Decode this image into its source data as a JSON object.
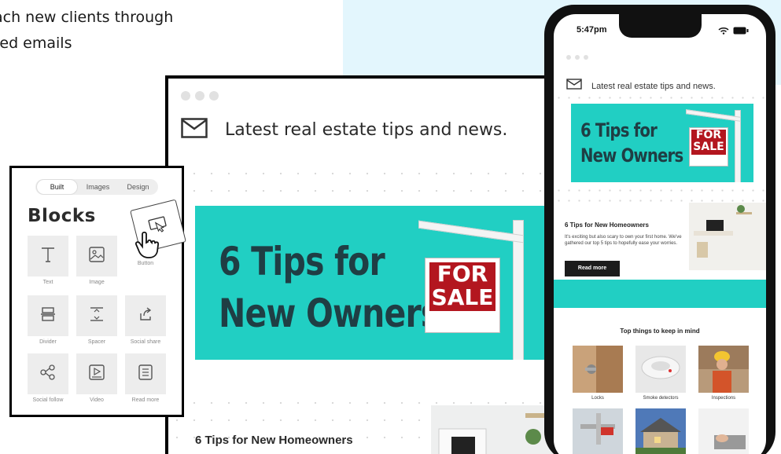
{
  "hero": {
    "line1": "ach new clients through",
    "line2": "red emails"
  },
  "desktop": {
    "mail_title": "Latest real estate tips and news.",
    "banner_line1": "6 Tips for",
    "banner_line2": "New Owners",
    "sign_top": "FOR",
    "sign_bottom": "SALE",
    "article_title": "6  Tips for New Homeowners"
  },
  "builder": {
    "tabs": [
      "Built",
      "Images",
      "Design"
    ],
    "title": "Blocks",
    "blocks": [
      {
        "label": "Text",
        "icon": "text-icon"
      },
      {
        "label": "Image",
        "icon": "image-icon"
      },
      {
        "label": "Button",
        "icon": "cursor-icon"
      },
      {
        "label": "Divider",
        "icon": "divider-icon"
      },
      {
        "label": "Spacer",
        "icon": "spacer-icon"
      },
      {
        "label": "Social share",
        "icon": "share-icon"
      },
      {
        "label": "Social follow",
        "icon": "social-follow-icon"
      },
      {
        "label": "Video",
        "icon": "video-icon"
      },
      {
        "label": "Read more",
        "icon": "read-more-icon"
      }
    ]
  },
  "phone": {
    "time": "5:47pm",
    "mail_title": "Latest real estate tips and news.",
    "banner_line1": "6 Tips for",
    "banner_line2": "New Owners",
    "sign_top": "FOR",
    "sign_bottom": "SALE",
    "article_title": "6  Tips for New Homeowners",
    "article_body": "It's exciting but also scary to own your first home. We've gathered our top 5 tips to hopefully ease your worries.",
    "read_more": "Read more",
    "things_title": "Top things to keep in mind",
    "things": [
      "Locks",
      "Smoke detectors",
      "Inspections"
    ]
  },
  "colors": {
    "teal": "#21cfc3",
    "banner_text": "#1f3e44",
    "sign_red": "#b3161f",
    "panel_bg": "#e3f6fd"
  }
}
